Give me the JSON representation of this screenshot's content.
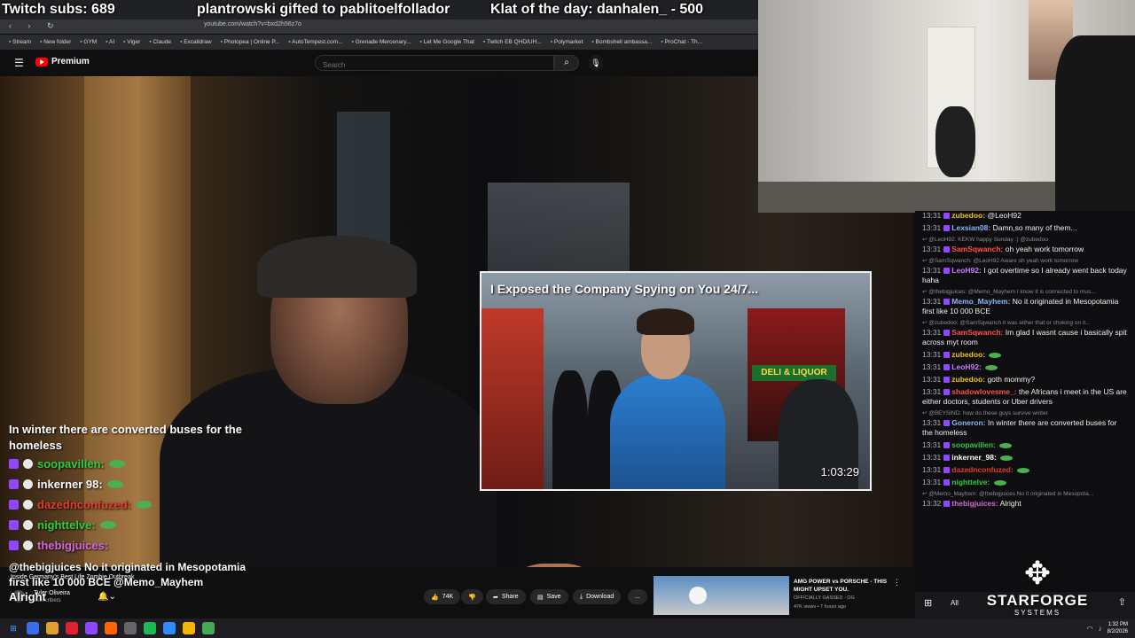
{
  "stream_overlay": {
    "subs": "Twitch subs: 689",
    "gifted": "plantrowski gifted to pablitoelfollador",
    "klat": "Klat of the day: danhalen_ - 500"
  },
  "browser": {
    "url": "youtube.com/watch?v=bxd2h56z7o",
    "bookmarks": [
      "Stream",
      "New folder",
      "GYM",
      "AI",
      "Viger",
      "Claude",
      "Excalidraw",
      "Photopea | Online P...",
      "AutoTempest.com...",
      "Grenade Mercenary...",
      "Let Me Google That",
      "Twitch EB QHD/UH...",
      "Polymarket",
      "Bombshell ambassa...",
      "ProChat - Th..."
    ]
  },
  "youtube": {
    "logo_text": "Premium",
    "search_placeholder": "Search",
    "video_title": "Inside Germany's Best Life Zombie Outbreak",
    "channel": "Tyler Oliveira",
    "subscribers": "subscribers",
    "likes": "74K",
    "share_label": "Share",
    "save_label": "Save",
    "download_label": "Download",
    "more_label": "...",
    "thumbnail": {
      "title": "I Exposed the Company Spying on You 24/7...",
      "duration": "1:03:29",
      "deli_sign": "DELI & LIQUOR"
    },
    "recommended": {
      "title": "AMG POWER vs PORSCHE - THIS MIGHT UPSET YOU.",
      "channel": "OFFICIALLY GASSED - OG",
      "views": "47K views • 7 hours ago"
    }
  },
  "chat_overlay": {
    "first_message": "In winter there are converted buses for the homeless",
    "rows": [
      {
        "name": "soopavillen:",
        "color": "#2ecc40"
      },
      {
        "name": "inkerner 98:",
        "color": "#ffffff"
      },
      {
        "name": "dazednconfuzed:",
        "color": "#e03c31"
      },
      {
        "name": "nighttelve:",
        "color": "#2ecc40"
      },
      {
        "name": "thebigjuices:",
        "color": "#d06bd6"
      }
    ],
    "reply_message": "@thebigjuices No it originated in Mesopotamia first like 10 000 BCE @Memo_Mayhem",
    "last_message": "Alright"
  },
  "twitch_chat": {
    "lines": [
      {
        "type": "msg",
        "ts": "13:31",
        "user": "zubedoo:",
        "color": "#f1c40f",
        "text": "@LeoH92"
      },
      {
        "type": "msg",
        "ts": "13:31",
        "user": "Lexsian08:",
        "color": "#8ab4f8",
        "text": "Damn,so many of them..."
      },
      {
        "type": "reply",
        "text": "↩ @LeoH92: KEKW happy Sunday :) @zubedoo"
      },
      {
        "type": "msg",
        "ts": "13:31",
        "user": "SamSqwanch:",
        "color": "#ff4d4d",
        "text": "oh yeah work tomorrow"
      },
      {
        "type": "reply",
        "text": "↩ @SamSqwanch: @LeoH92 Aware oh yeah work tomorrow"
      },
      {
        "type": "msg",
        "ts": "13:31",
        "user": "LeoH92:",
        "color": "#c77dff",
        "text": "I got overtime so I already went back today haha"
      },
      {
        "type": "reply",
        "text": "↩ @thebigjuices: @Memo_Mayhem I know it is connected to mus..."
      },
      {
        "type": "msg",
        "ts": "13:31",
        "user": "Memo_Mayhem:",
        "color": "#8ab4f8",
        "text": "No it originated in Mesopotamia first like 10 000 BCE"
      },
      {
        "type": "reply",
        "text": "↩ @zubedoo: @SamSqwanch it was either that or choking on it..."
      },
      {
        "type": "msg",
        "ts": "13:31",
        "user": "SamSqwanch:",
        "color": "#ff4d4d",
        "text": "Im glad I wasnt cause i basically spit across myt room"
      },
      {
        "type": "msg",
        "ts": "13:31",
        "user": "zubedoo:",
        "color": "#f1c40f",
        "text": ""
      },
      {
        "type": "msg",
        "ts": "13:31",
        "user": "LeoH92:",
        "color": "#c77dff",
        "text": ""
      },
      {
        "type": "msg",
        "ts": "13:31",
        "user": "zubedoo:",
        "color": "#f1c40f",
        "text": "goth mommy?"
      },
      {
        "type": "msg",
        "ts": "13:31",
        "user": "shadowlovesme_:",
        "color": "#ff4d4d",
        "text": "the Africans i meet in the US are either doctors, students or Uber drivers"
      },
      {
        "type": "reply",
        "text": "↩ @BEYSIND: how do these guys survive winter"
      },
      {
        "type": "msg",
        "ts": "13:31",
        "user": "Goneron:",
        "color": "#8ab4f8",
        "text": "In winter there are converted buses for the homeless"
      },
      {
        "type": "msg",
        "ts": "13:31",
        "user": "soopavillen:",
        "color": "#2ecc40",
        "text": ""
      },
      {
        "type": "msg",
        "ts": "13:31",
        "user": "inkerner_98:",
        "color": "#ffffff",
        "text": ""
      },
      {
        "type": "msg",
        "ts": "13:31",
        "user": "dazednconfuzed:",
        "color": "#e03c31",
        "text": ""
      },
      {
        "type": "msg",
        "ts": "13:31",
        "user": "nighttelve:",
        "color": "#2ecc40",
        "text": ""
      },
      {
        "type": "reply",
        "text": "↩ @Memo_Mayhem: @thebigjuices No it originated in Mesopota..."
      },
      {
        "type": "msg",
        "ts": "13:32",
        "user": "thebigjuices:",
        "color": "#d06bd6",
        "text": "Alright"
      }
    ],
    "footer_all": "All"
  },
  "branding": {
    "name": "STARFORGE",
    "sub": "SYSTEMS"
  },
  "taskbar": {
    "time": "1:32 PM",
    "date": "8/2/2026"
  }
}
